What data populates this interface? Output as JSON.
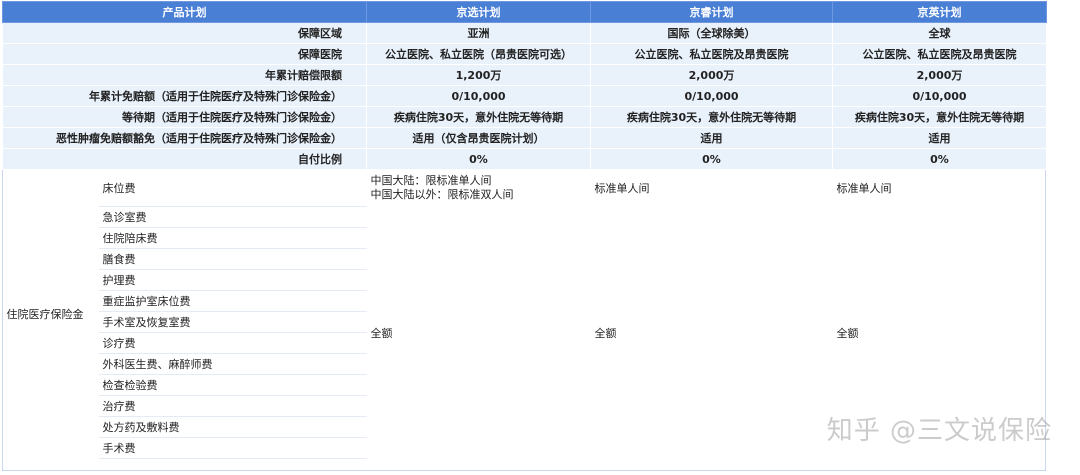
{
  "header": {
    "col0": "产品计划",
    "col1": "京选计划",
    "col2": "京睿计划",
    "col3": "京英计划"
  },
  "summary_rows": [
    {
      "label": "保障区域",
      "v1": "亚洲",
      "v2": "国际（全球除美）",
      "v3": "全球"
    },
    {
      "label": "保障医院",
      "v1": "公立医院、私立医院（昂贵医院可选）",
      "v2": "公立医院、私立医院及昂贵医院",
      "v3": "公立医院、私立医院及昂贵医院"
    },
    {
      "label": "年累计赔偿限额",
      "v1": "1,200万",
      "v2": "2,000万",
      "v3": "2,000万"
    },
    {
      "label": "年累计免赔额（适用于住院医疗及特殊门诊保险金）",
      "v1": "0/10,000",
      "v2": "0/10,000",
      "v3": "0/10,000"
    },
    {
      "label": "等待期（适用于住院医疗及特殊门诊保险金）",
      "v1": "疾病住院30天，意外住院无等待期",
      "v2": "疾病住院30天，意外住院无等待期",
      "v3": "疾病住院30天，意外住院无等待期"
    },
    {
      "label": "恶性肿瘤免赔额豁免（适用于住院医疗及特殊门诊保险金）",
      "v1": "适用（仅含昂贵医院计划）",
      "v2": "适用",
      "v3": "适用"
    },
    {
      "label": "自付比例",
      "v1": "0%",
      "v2": "0%",
      "v3": "0%"
    }
  ],
  "inpatient": {
    "category": "住院医疗保险金",
    "bed": {
      "item": "床位费",
      "v1_line1": "中国大陆：限标准单人间",
      "v1_line2": "中国大陆以外：限标准双人间",
      "v2": "标准单人间",
      "v3": "标准单人间"
    },
    "items": [
      "急诊室费",
      "住院陪床费",
      "膳食费",
      "护理费",
      "重症监护室床位费",
      "手术室及恢复室费",
      "诊疗费",
      "外科医生费、麻醉师费",
      "检查检验费",
      "治疗费",
      "处方药及敷料费",
      "手术费"
    ],
    "full_amount": "全额"
  },
  "watermark": "知乎 @三文说保险"
}
